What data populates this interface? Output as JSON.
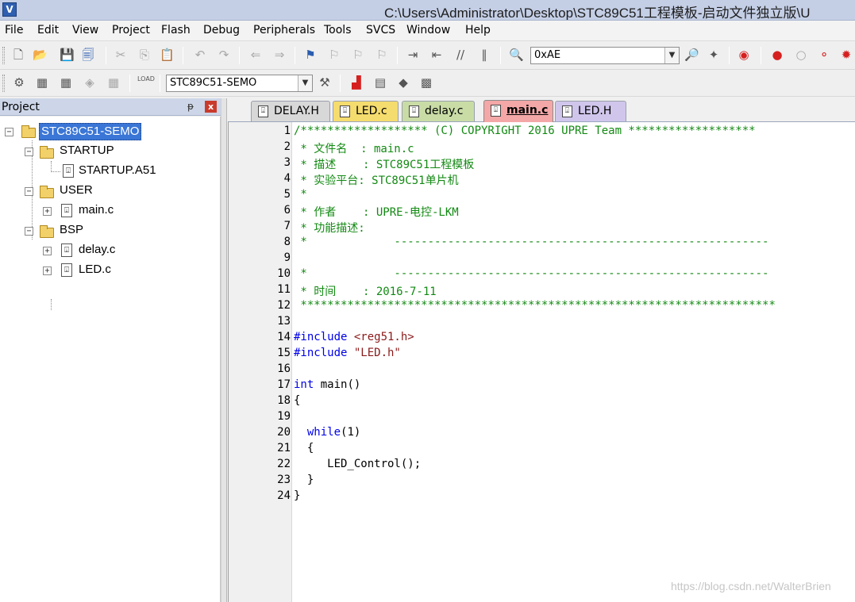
{
  "window": {
    "title": "C:\\Users\\Administrator\\Desktop\\STC89C51工程模板-启动文件独立版\\U",
    "app_icon": "keil-icon"
  },
  "menu": [
    "File",
    "Edit",
    "View",
    "Project",
    "Flash",
    "Debug",
    "Peripherals",
    "Tools",
    "SVCS",
    "Window",
    "Help"
  ],
  "toolbar1": {
    "find_value": "0xAE"
  },
  "toolbar2": {
    "target_value": "STC89C51-SEMO",
    "load_label": "LOAD"
  },
  "project": {
    "title": "Project",
    "pin_glyph": "ᵽ",
    "close_glyph": "x",
    "root": "STC89C51-SEMO",
    "groups": [
      {
        "name": "STARTUP",
        "files": [
          "STARTUP.A51"
        ]
      },
      {
        "name": "USER",
        "files": [
          "main.c"
        ]
      },
      {
        "name": "BSP",
        "files": [
          "delay.c",
          "LED.c"
        ]
      }
    ]
  },
  "tabs": [
    {
      "label": "DELAY.H",
      "color": "#d8d8d8",
      "active": false
    },
    {
      "label": "LED.c",
      "color": "#f5dc6e",
      "active": false
    },
    {
      "label": "delay.c",
      "color": "#c9dca6",
      "active": false
    },
    {
      "label": "main.c",
      "color": "#f4a7a7",
      "active": true
    },
    {
      "label": "LED.H",
      "color": "#d0c6ec",
      "active": false
    }
  ],
  "code_lines": [
    {
      "n": "1",
      "text": "/******************* (C) COPYRIGHT 2016 UPRE Team *******************"
    },
    {
      "n": "2",
      "text": " * 文件名  : main.c"
    },
    {
      "n": "3",
      "text": " * 描述    : STC89C51工程模板"
    },
    {
      "n": "4",
      "text": " * 实验平台: STC89C51单片机"
    },
    {
      "n": "5",
      "text": " *"
    },
    {
      "n": "6",
      "text": " * 作者    : UPRE-电控-LKM"
    },
    {
      "n": "7",
      "text": " * 功能描述:"
    },
    {
      "n": "8",
      "text": " *             --------------------------------------------------------"
    },
    {
      "n": "9",
      "text": ""
    },
    {
      "n": "10",
      "text": " *             --------------------------------------------------------"
    },
    {
      "n": "11",
      "text": " * 时间    : 2016-7-11"
    },
    {
      "n": "12",
      "text": " ***********************************************************************"
    },
    {
      "n": "13",
      "text": ""
    },
    {
      "n": "14",
      "p1": "#include ",
      "p2": "<reg51.h>"
    },
    {
      "n": "15",
      "p1": "#include ",
      "p2": "\"LED.h\""
    },
    {
      "n": "16",
      "text": ""
    },
    {
      "n": "17",
      "kw": "int",
      "rest": " main()"
    },
    {
      "n": "18",
      "text": "{"
    },
    {
      "n": "19",
      "text": ""
    },
    {
      "n": "20",
      "indent": "  ",
      "kw": "while",
      "rest": "(1)"
    },
    {
      "n": "21",
      "text": "  {"
    },
    {
      "n": "22",
      "text": "     LED_Control();"
    },
    {
      "n": "23",
      "text": "  }"
    },
    {
      "n": "24",
      "text": "}"
    }
  ],
  "watermark": "https://blog.csdn.net/WalterBrien"
}
